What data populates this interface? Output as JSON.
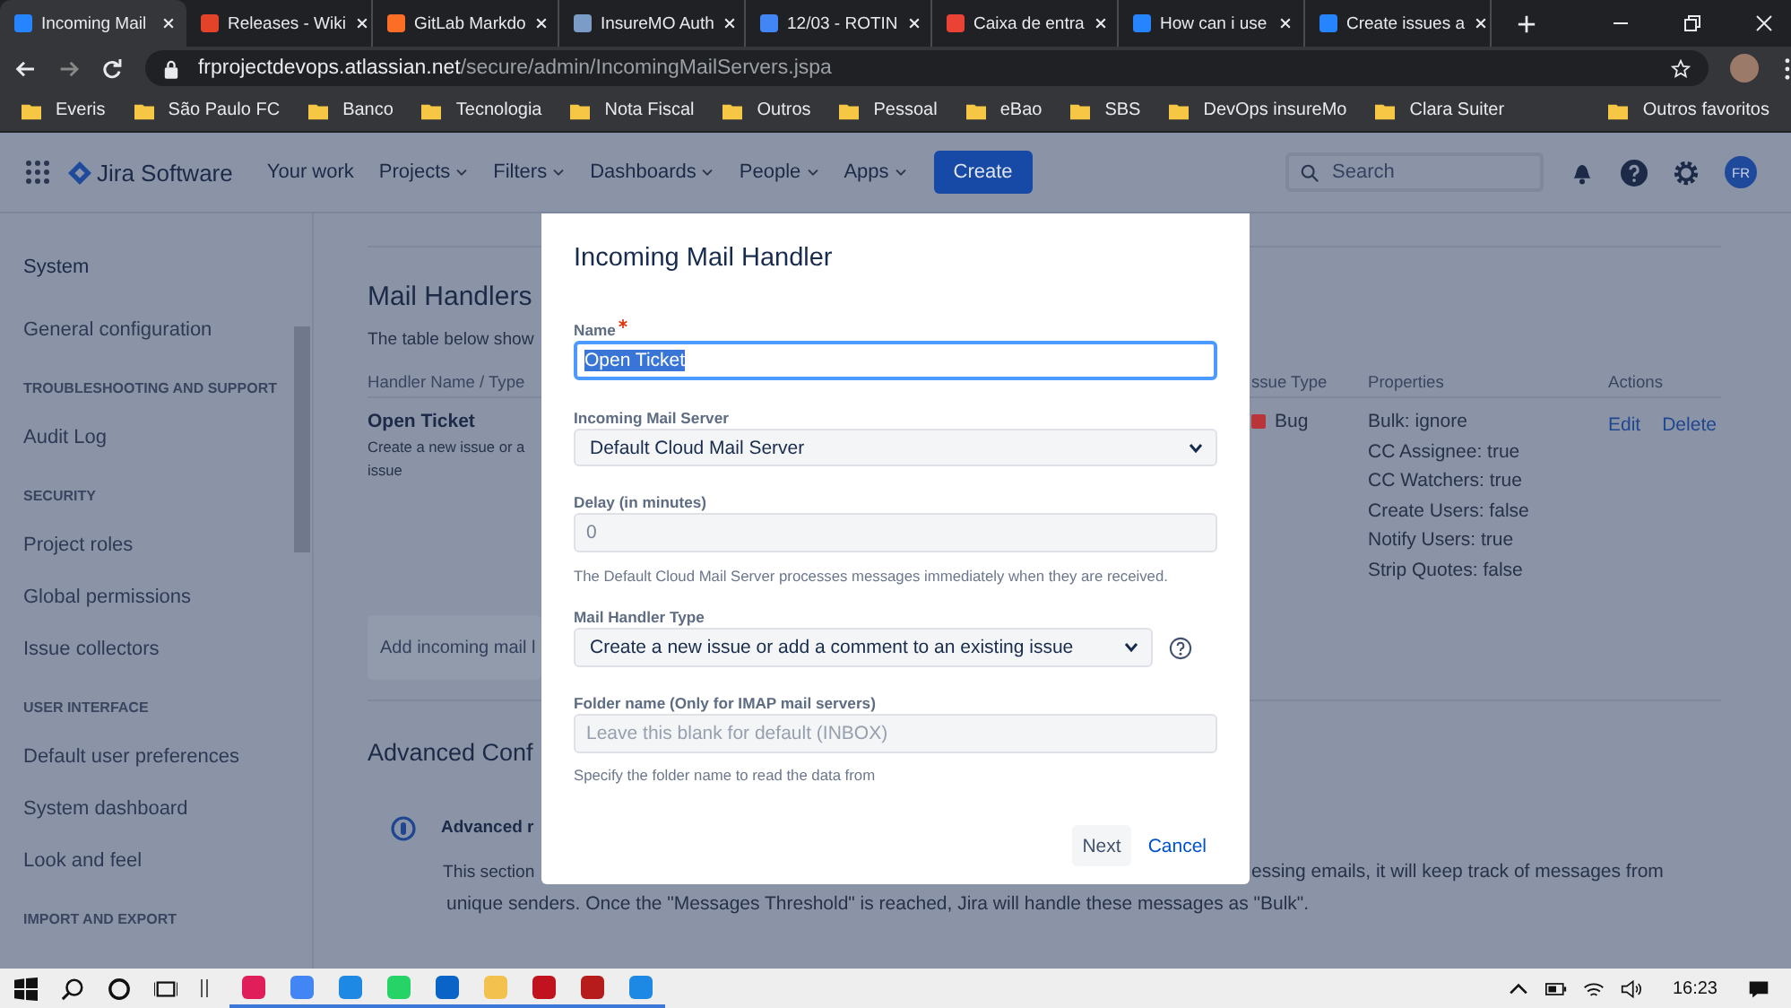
{
  "browser": {
    "tabs": [
      {
        "title": "Incoming Mail",
        "selected": true,
        "color": "#2684ff"
      },
      {
        "title": "Releases - Wiki",
        "selected": false,
        "color": "#e24329"
      },
      {
        "title": "GitLab Markdo",
        "selected": false,
        "color": "#fc6d26"
      },
      {
        "title": "InsureMO Auth",
        "selected": false,
        "color": "#7a9cc6"
      },
      {
        "title": "12/03 - ROTIN",
        "selected": false,
        "color": "#4285f4"
      },
      {
        "title": "Caixa de entra",
        "selected": false,
        "color": "#ea4335"
      },
      {
        "title": "How can i use",
        "selected": false,
        "color": "#2684ff"
      },
      {
        "title": "Create issues a",
        "selected": false,
        "color": "#2684ff"
      }
    ],
    "address": {
      "host": "frprojectdevops.atlassian.net",
      "path": "/secure/admin/IncomingMailServers.jspa"
    },
    "bookmarks": [
      "Everis",
      "São Paulo FC",
      "Banco",
      "Tecnologia",
      "Nota Fiscal",
      "Outros",
      "Pessoal",
      "eBao",
      "SBS",
      "DevOps insureMo",
      "Clara Suiter"
    ],
    "other_bookmarks": "Outros favoritos"
  },
  "jira": {
    "product": "Jira Software",
    "nav": [
      {
        "label": "Your work",
        "dropdown": false
      },
      {
        "label": "Projects",
        "dropdown": true
      },
      {
        "label": "Filters",
        "dropdown": true
      },
      {
        "label": "Dashboards",
        "dropdown": true
      },
      {
        "label": "People",
        "dropdown": true
      },
      {
        "label": "Apps",
        "dropdown": true
      }
    ],
    "create": "Create",
    "search_placeholder": "Search",
    "avatar": "FR"
  },
  "sidebar": {
    "title": "System",
    "items": [
      {
        "kind": "link",
        "label": "General configuration"
      },
      {
        "kind": "heading",
        "label": "TROUBLESHOOTING AND SUPPORT"
      },
      {
        "kind": "link",
        "label": "Audit Log"
      },
      {
        "kind": "heading",
        "label": "SECURITY"
      },
      {
        "kind": "link",
        "label": "Project roles"
      },
      {
        "kind": "link",
        "label": "Global permissions"
      },
      {
        "kind": "link",
        "label": "Issue collectors"
      },
      {
        "kind": "heading",
        "label": "USER INTERFACE"
      },
      {
        "kind": "link",
        "label": "Default user preferences"
      },
      {
        "kind": "link",
        "label": "System dashboard"
      },
      {
        "kind": "link",
        "label": "Look and feel"
      },
      {
        "kind": "heading",
        "label": "IMPORT AND EXPORT"
      }
    ]
  },
  "page": {
    "heading": "Mail Handlers",
    "intro": "The table below show",
    "columns": [
      "Handler Name / Type",
      "ssue Type",
      "Properties",
      "Actions"
    ],
    "handler": {
      "name": "Open Ticket",
      "type_lines": [
        "Create a new issue or a",
        "issue"
      ],
      "issue_type": "Bug",
      "properties": [
        "Bulk: ignore",
        "CC Assignee: true",
        "CC Watchers: true",
        "Create Users: false",
        "Notify Users: true",
        "Strip Quotes: false"
      ],
      "actions": [
        "Edit",
        "Delete"
      ]
    },
    "add_button": "Add incoming mail l",
    "advanced_heading": "Advanced Conf",
    "notice_title": "Advanced r",
    "notice_line1_left": "This section",
    "notice_line1_right": "essing emails, it will keep track of messages from",
    "notice_line2": "unique senders. Once the \"Messages Threshold\" is reached, Jira will handle these messages as \"Bulk\"."
  },
  "modal": {
    "title": "Incoming Mail Handler",
    "name": {
      "label": "Name",
      "required": true,
      "value": "Open Ticket",
      "highlighted": true
    },
    "server": {
      "label": "Incoming Mail Server",
      "value": "Default Cloud Mail Server"
    },
    "delay": {
      "label": "Delay (in minutes)",
      "value": "0",
      "disabled": true,
      "help": "The Default Cloud Mail Server processes messages immediately when they are received."
    },
    "handler_type": {
      "label": "Mail Handler Type",
      "value": "Create a new issue or add a comment to an existing issue"
    },
    "folder": {
      "label": "Folder name (Only for IMAP mail servers)",
      "placeholder": "Leave this blank for default (INBOX)",
      "help": "Specify the folder name to read the data from"
    },
    "buttons": {
      "next": "Next",
      "cancel": "Cancel"
    }
  },
  "taskbar": {
    "time": "16:23"
  }
}
